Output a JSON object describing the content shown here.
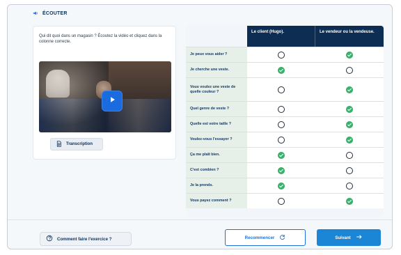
{
  "header": {
    "title": "ÉCOUTER",
    "icon": "speaker-icon"
  },
  "left": {
    "instructions": "Qui dit quoi dans un magasin ? Écoutez la vidéo et cliquez dans la colonne correcte.",
    "video": {
      "play_icon": "play-icon"
    },
    "transcription_button": {
      "label": "Transcription",
      "icon": "document-icon"
    }
  },
  "table": {
    "headers": [
      "Le client (Hugo).",
      "Le vendeur ou la vendeuse."
    ],
    "rows": [
      {
        "question": "Je peux vous aider ?",
        "client": "radio",
        "vendeur": "check"
      },
      {
        "question": "Je cherche une veste.",
        "client": "check",
        "vendeur": "radio"
      },
      {
        "question": "Vous voulez une veste de quelle couleur ?",
        "client": "radio",
        "vendeur": "check"
      },
      {
        "question": "Quel genre de veste ?",
        "client": "radio",
        "vendeur": "check"
      },
      {
        "question": "Quelle est votre taille ?",
        "client": "radio",
        "vendeur": "check"
      },
      {
        "question": "Voulez-vous l'essayer ?",
        "client": "radio",
        "vendeur": "check"
      },
      {
        "question": "Ça me plaît bien.",
        "client": "check",
        "vendeur": "radio"
      },
      {
        "question": "C'est combien ?",
        "client": "check",
        "vendeur": "radio"
      },
      {
        "question": "Je la prends.",
        "client": "check",
        "vendeur": "radio"
      },
      {
        "question": "Vous payez comment ?",
        "client": "radio",
        "vendeur": "check"
      }
    ]
  },
  "footer": {
    "help_label": "Comment faire l'exercice ?",
    "help_icon": "help-circle-icon",
    "restart_label": "Recommencer",
    "restart_icon": "refresh-icon",
    "next_label": "Suivant",
    "next_icon": "arrow-right-icon"
  },
  "colors": {
    "navy": "#0e2d52",
    "check_green": "#39b36b",
    "primary_blue": "#1c86d6"
  }
}
